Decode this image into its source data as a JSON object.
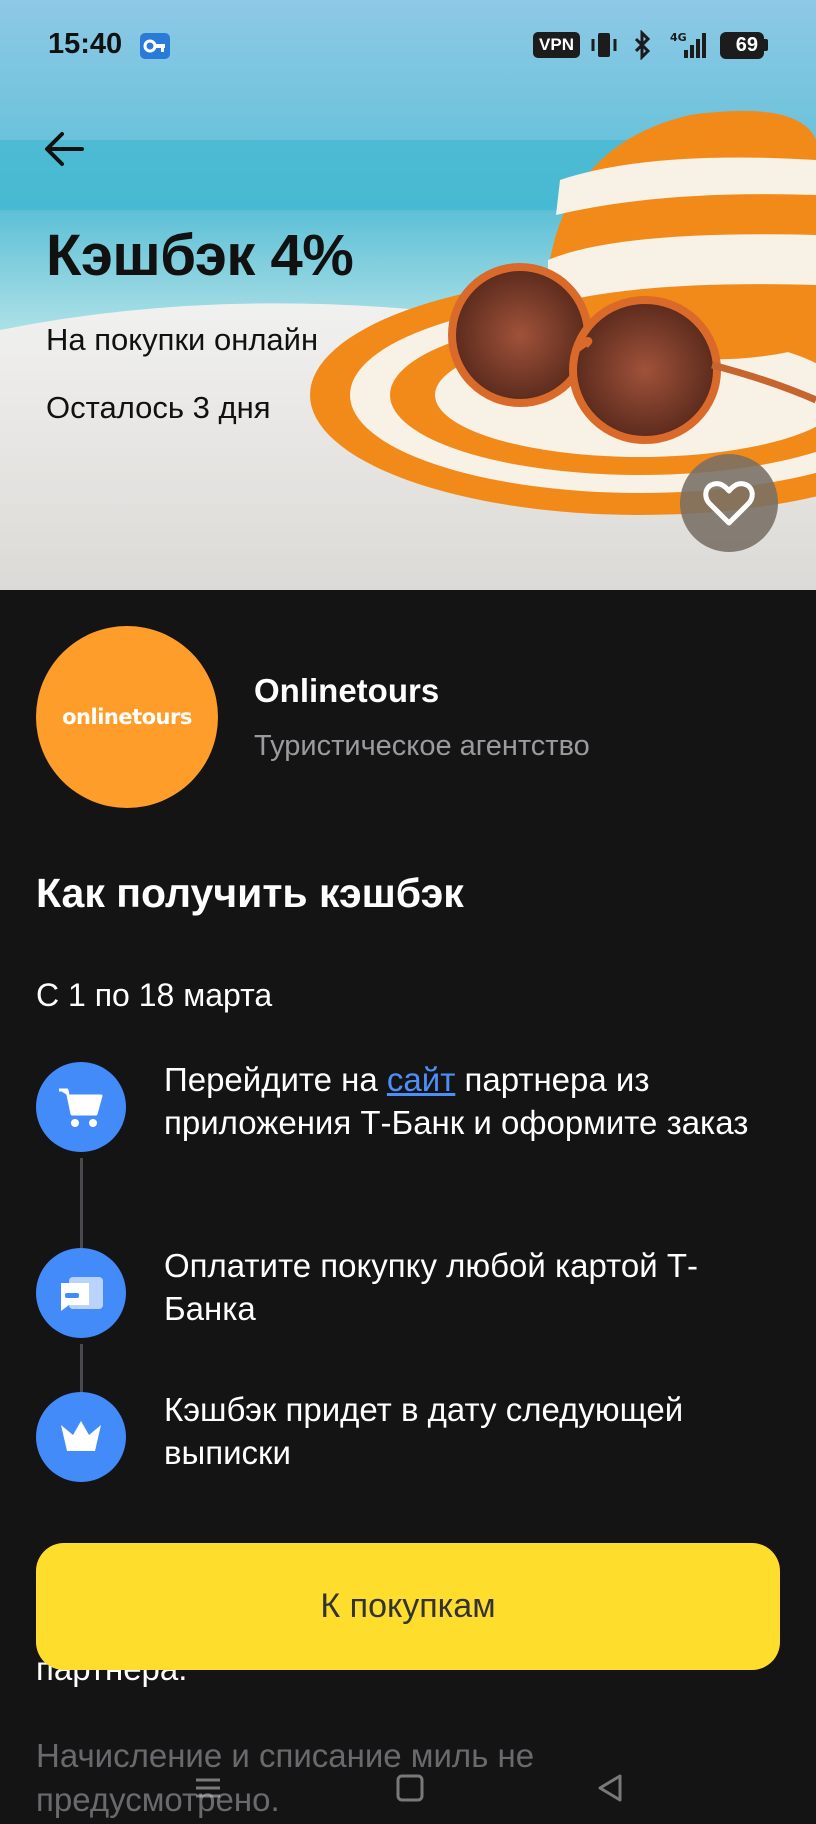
{
  "status_bar": {
    "time": "15:40",
    "vpn": "VPN",
    "battery": "69",
    "icons": [
      "key-icon",
      "vibrate-icon",
      "bluetooth-icon",
      "signal-4g-icon",
      "battery-icon"
    ]
  },
  "hero": {
    "title": "Кэшбэк 4%",
    "subtitle": "На покупки онлайн",
    "remaining": "Осталось 3 дня"
  },
  "partner": {
    "logo_text": "onlinetours",
    "logo_color": "#ff9d2a",
    "name": "Onlinetours",
    "category": "Туристическое агентство"
  },
  "how_to": {
    "title": "Как получить кэшбэк",
    "period": "С 1 по 18 марта",
    "steps": [
      {
        "icon": "cart-icon",
        "text_before": "Перейдите на ",
        "link": "сайт",
        "text_after": " партнера из приложения Т-Банк и оформите заказ"
      },
      {
        "icon": "card-icon",
        "text": "Оплатите покупку любой картой Т-Банка"
      },
      {
        "icon": "crown-icon",
        "text": "Кэшбэк придет в дату следующей выписки"
      }
    ]
  },
  "behind_text": {
    "line1": "партнера.",
    "line2": "Начисление и списание миль не предусмотрено."
  },
  "cta": {
    "label": "К покупкам",
    "color": "#ffdd2d"
  },
  "nav": [
    "menu-icon",
    "home-icon",
    "back-triangle-icon"
  ],
  "colors": {
    "background": "#141414",
    "accent_blue": "#428bf9",
    "link": "#4d8ff8"
  }
}
